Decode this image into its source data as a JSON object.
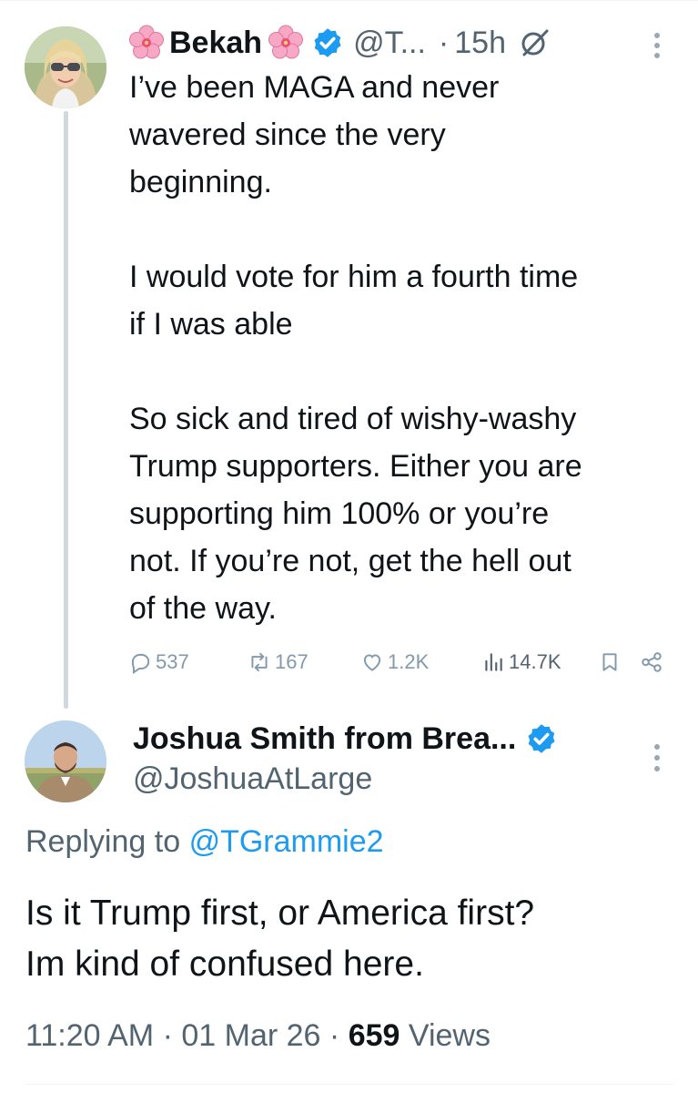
{
  "parent_tweet": {
    "display_name": "Bekah",
    "name_emoji": "flower-icon",
    "verified": true,
    "handle": "@T...",
    "separator": "·",
    "time": "15h",
    "body": "I’ve been MAGA and never\nwavered since the very\nbeginning.\n\nI would vote for him a fourth time\nif I was able\n\nSo sick and tired of wishy-washy\nTrump supporters. Either you are\nsupporting him 100% or you’re\nnot. If you’re not, get the hell out\nof the way.",
    "actions": {
      "replies": "537",
      "retweets": "167",
      "likes": "1.2K",
      "views": "14.7K"
    }
  },
  "reply_tweet": {
    "display_name": "Joshua Smith from Brea...",
    "verified": true,
    "handle": "@JoshuaAtLarge",
    "replying_label": "Replying to",
    "replying_to": "@TGrammie2",
    "body": "Is it Trump first, or America first?\nIm kind of confused here.",
    "time": "11:20 AM",
    "date": "01 Mar 26",
    "separator": "·",
    "views_count": "659",
    "views_label": "Views"
  },
  "colors": {
    "text": "#0f1419",
    "secondary": "#536471",
    "accent": "#1d9bf0",
    "muted_actions": "#829aab",
    "thread_line": "#cfd9de"
  }
}
